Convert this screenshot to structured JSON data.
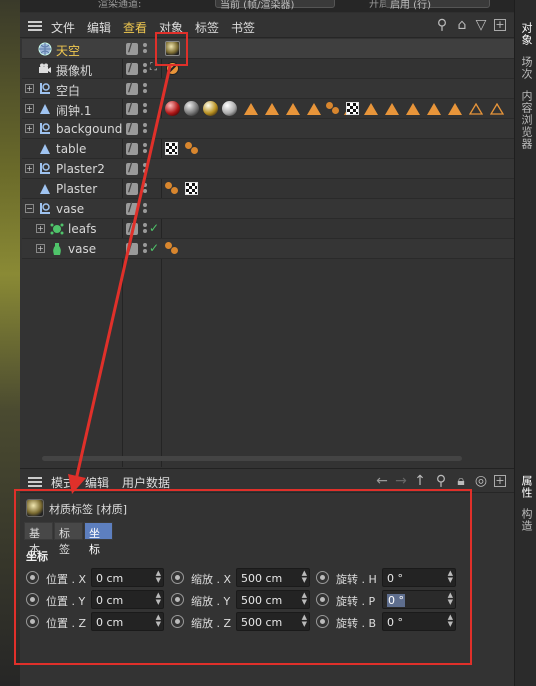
{
  "top": {
    "left_label": "渲染通道:",
    "left_value": "当前 (帧/渲染器)",
    "right_label": "开启:",
    "right_value": "启用 (行)"
  },
  "object_manager": {
    "menu": [
      "文件",
      "编辑",
      "查看",
      "对象",
      "标签",
      "书签"
    ],
    "objects": [
      {
        "name": "天空",
        "icon": "sky-icon",
        "highlight": true
      },
      {
        "name": "摄像机",
        "icon": "camera-icon"
      },
      {
        "name": "空白",
        "icon": "null-icon"
      },
      {
        "name": "闹钟.1",
        "icon": "polygon-icon"
      },
      {
        "name": "backgound",
        "icon": "null-icon"
      },
      {
        "name": "table",
        "icon": "polygon-icon"
      },
      {
        "name": "Plaster2",
        "icon": "null-icon"
      },
      {
        "name": "Plaster",
        "icon": "polygon-icon"
      },
      {
        "name": "vase",
        "icon": "null-icon"
      },
      {
        "name": "leafs",
        "icon": "cloner-icon"
      },
      {
        "name": "vase",
        "icon": "lathe-icon"
      }
    ]
  },
  "attribute_manager": {
    "menu": [
      "模式",
      "编辑",
      "用户数据"
    ],
    "title": "材质标签 [材质]",
    "tabs": [
      "基本",
      "标签",
      "坐标"
    ],
    "active_tab": "坐标",
    "section": "坐标",
    "fields": [
      [
        {
          "label": "位置 . X",
          "value": "0 cm"
        },
        {
          "label": "缩放 . X",
          "value": "500 cm"
        },
        {
          "label": "旋转 . H",
          "value": "0 °"
        }
      ],
      [
        {
          "label": "位置 . Y",
          "value": "0 cm"
        },
        {
          "label": "缩放 . Y",
          "value": "500 cm"
        },
        {
          "label": "旋转 . P",
          "value": "0 °"
        }
      ],
      [
        {
          "label": "位置 . Z",
          "value": "0 cm"
        },
        {
          "label": "缩放 . Z",
          "value": "500 cm"
        },
        {
          "label": "旋转 . B",
          "value": "0 °"
        }
      ]
    ]
  },
  "right_tabs": [
    "对象",
    "场次",
    "内容浏览器",
    "属性",
    "构造"
  ],
  "colors": {
    "accent": "#5d7fbf",
    "highlight_text": "#f0c850",
    "annotation": "#e0302a",
    "tag_orange": "#e8953a"
  }
}
